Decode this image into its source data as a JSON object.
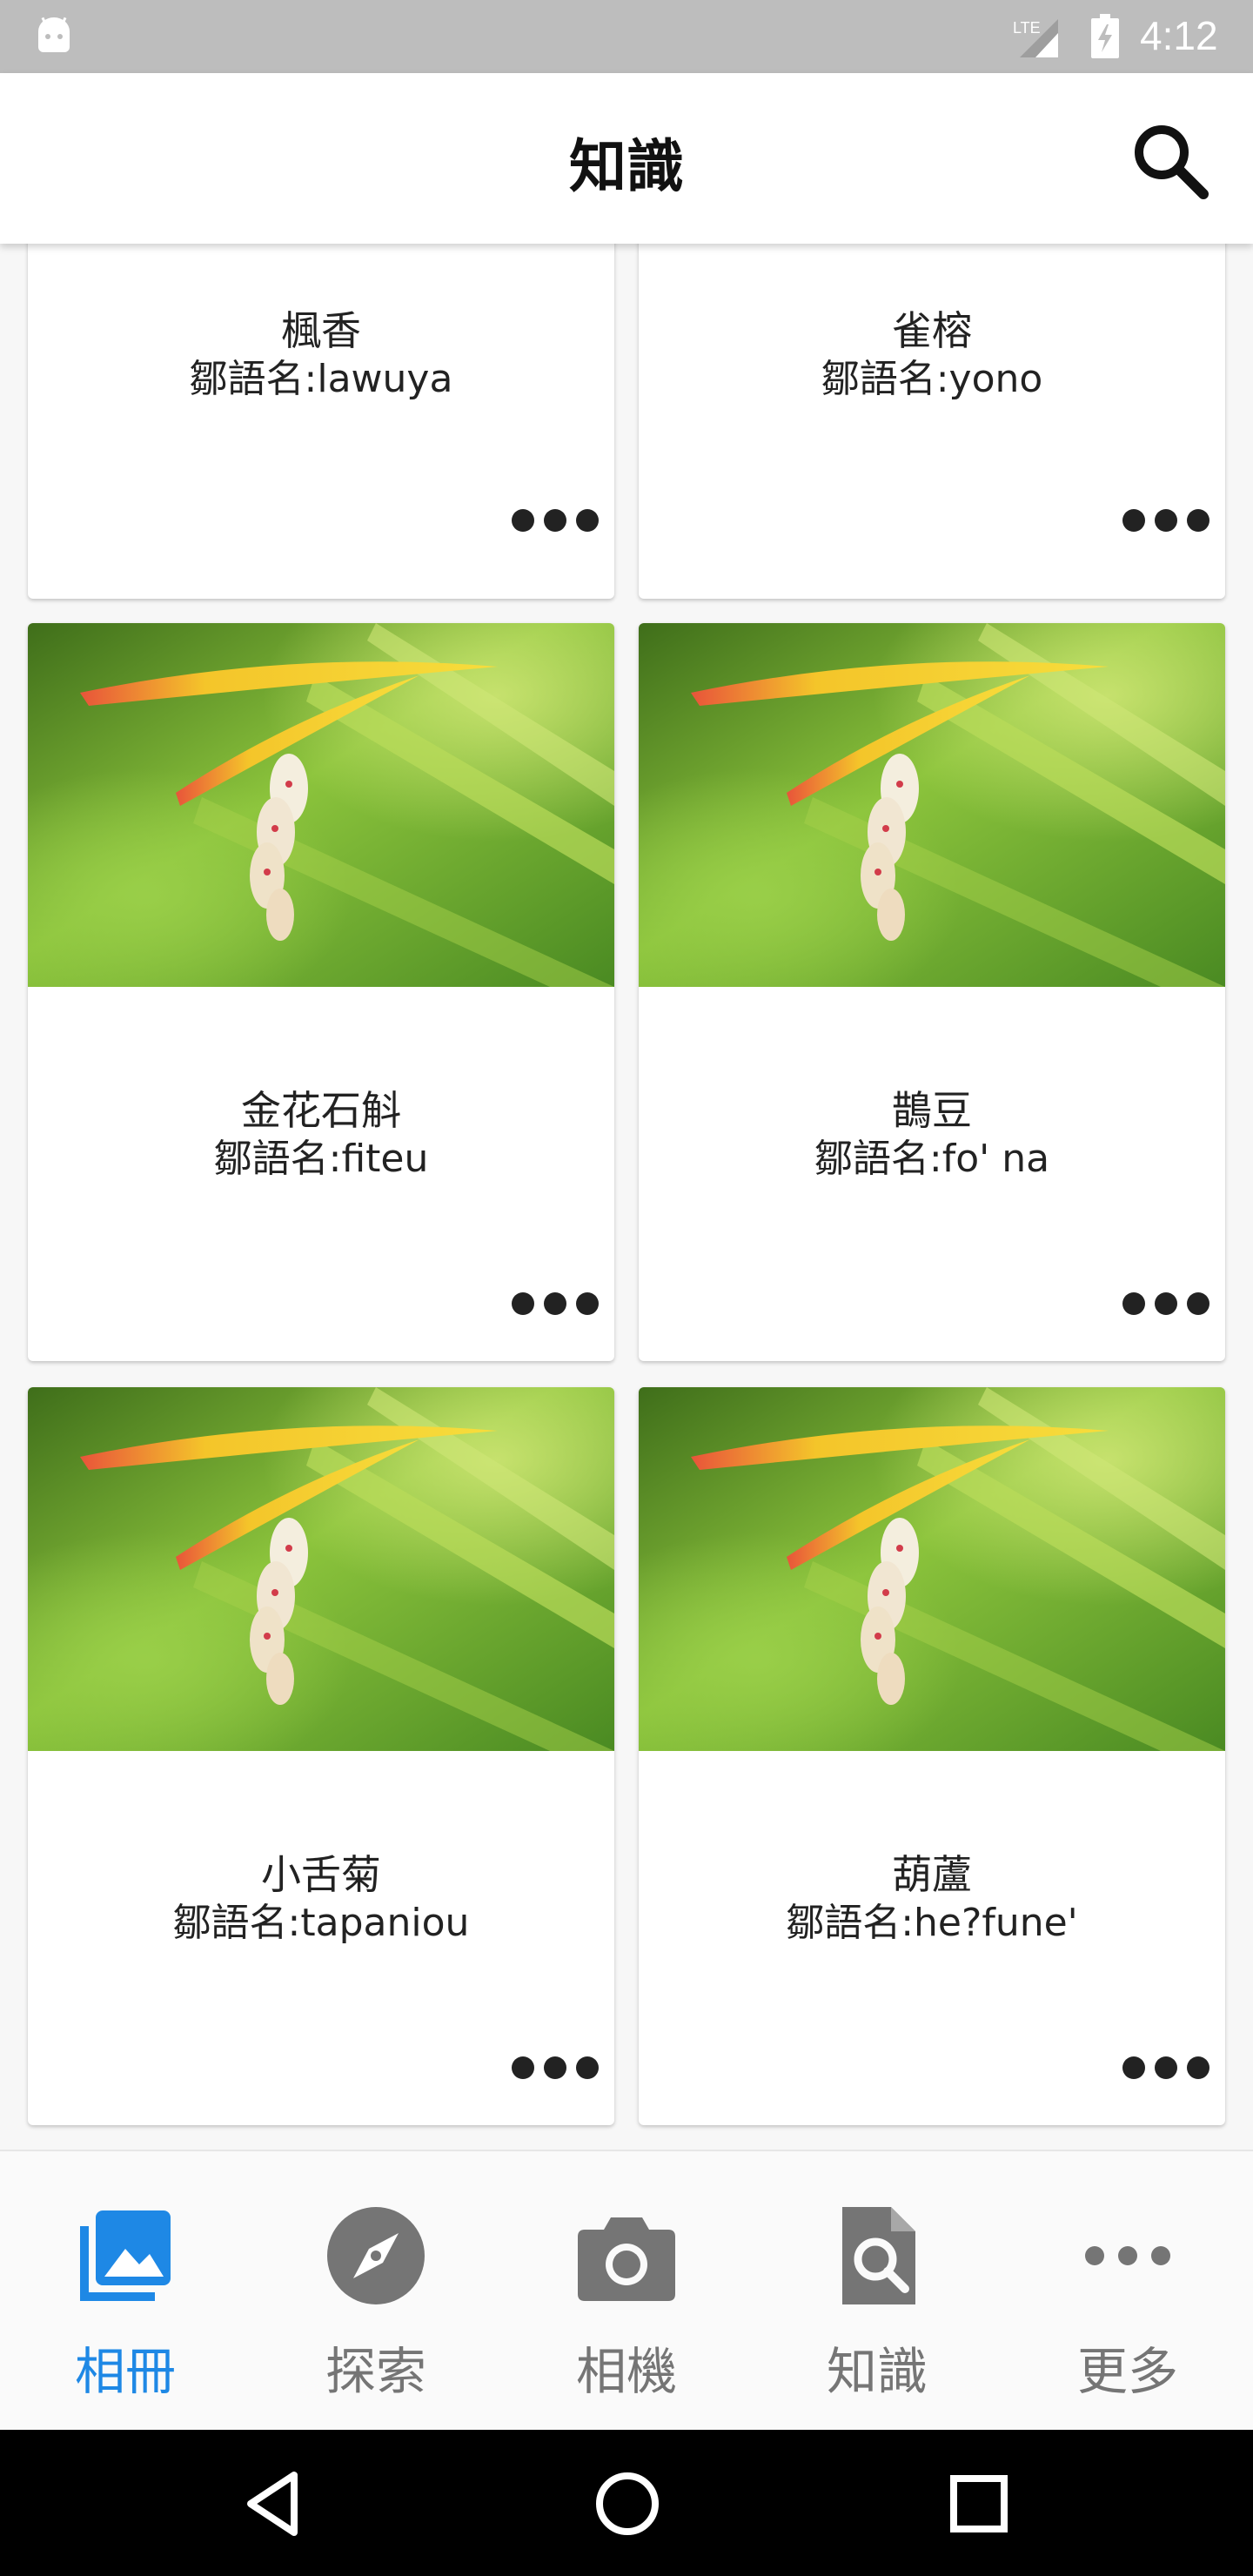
{
  "status_bar": {
    "time": "4:12",
    "network_label": "LTE",
    "icons": [
      "android-icon",
      "lte-signal-icon",
      "battery-charging-icon"
    ]
  },
  "app_bar": {
    "title": "知識",
    "search_icon": "search-icon"
  },
  "cards": [
    {
      "name": "楓香",
      "native_name": "鄒語名:lawuya",
      "has_image": false
    },
    {
      "name": "雀榕",
      "native_name": "鄒語名:yono",
      "has_image": false
    },
    {
      "name": "金花石斛",
      "native_name": "鄒語名:fiteu",
      "has_image": true
    },
    {
      "name": "鵲豆",
      "native_name": "鄒語名:fo' na",
      "has_image": true
    },
    {
      "name": "小舌菊",
      "native_name": "鄒語名:tapaniou",
      "has_image": true
    },
    {
      "name": "葫蘆",
      "native_name": "鄒語名:he?fune'",
      "has_image": true
    }
  ],
  "bottom_nav": {
    "items": [
      {
        "label": "相冊",
        "icon": "photo-album-icon",
        "active": true
      },
      {
        "label": "探索",
        "icon": "compass-icon",
        "active": false
      },
      {
        "label": "相機",
        "icon": "camera-icon",
        "active": false
      },
      {
        "label": "知識",
        "icon": "document-search-icon",
        "active": false
      },
      {
        "label": "更多",
        "icon": "more-dots-icon",
        "active": false
      }
    ]
  },
  "colors": {
    "accent": "#1e88e5",
    "inactive": "#757575",
    "status_bar": "#bdbdbd",
    "background": "#f7f7f7"
  }
}
